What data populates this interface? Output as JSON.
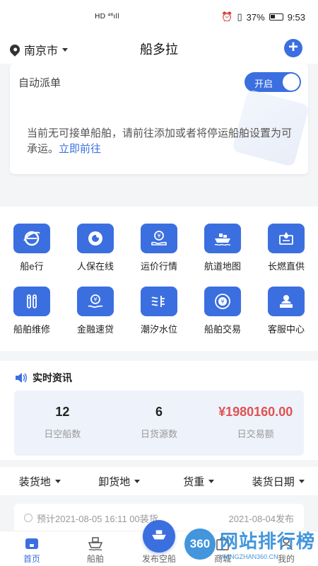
{
  "status_bar": {
    "left": "HD ⁴⁶ıll",
    "battery": "37%",
    "time": "9:53"
  },
  "header": {
    "location": "南京市",
    "title": "船多拉"
  },
  "dispatch": {
    "label": "自动派单",
    "toggle_label": "开启",
    "toggle_on": true,
    "empty_message": "当前无可接单船舶，请前往添加或者将停运船舶设置为可承运。",
    "empty_link": "立即前往"
  },
  "services": [
    {
      "label": "船e行",
      "icon": "e-icon"
    },
    {
      "label": "人保在线",
      "icon": "insurance-icon"
    },
    {
      "label": "运价行情",
      "icon": "freight-price-icon"
    },
    {
      "label": "航道地图",
      "icon": "ship-map-icon"
    },
    {
      "label": "长燃直供",
      "icon": "fuel-supply-icon"
    },
    {
      "label": "船舶维修",
      "icon": "repair-icon"
    },
    {
      "label": "金融速贷",
      "icon": "loan-icon"
    },
    {
      "label": "潮汐水位",
      "icon": "tide-icon"
    },
    {
      "label": "船舶交易",
      "icon": "trade-icon"
    },
    {
      "label": "客服中心",
      "icon": "service-icon"
    }
  ],
  "news": {
    "title": "实时资讯",
    "stats": [
      {
        "value": "12",
        "label": "日空船数"
      },
      {
        "value": "6",
        "label": "日货源数"
      },
      {
        "value": "¥1980160.00",
        "label": "日交易额"
      }
    ]
  },
  "filters": [
    "装货地",
    "卸货地",
    "货重",
    "装货日期"
  ],
  "listing": {
    "left": "预计2021-08-05 16:11 00装货",
    "right": "2021-08-04发布"
  },
  "tabs": [
    {
      "label": "首页",
      "active": true
    },
    {
      "label": "船舶"
    },
    {
      "label": "发布空船"
    },
    {
      "label": "商城"
    },
    {
      "label": "我的"
    }
  ],
  "watermark": {
    "badge": "360",
    "main": "网站排行榜",
    "sub": "WANGZHAN360.CN"
  },
  "colors": {
    "accent": "#3b6fe0",
    "money": "#e05252",
    "stats_bg": "#eef2fb"
  }
}
